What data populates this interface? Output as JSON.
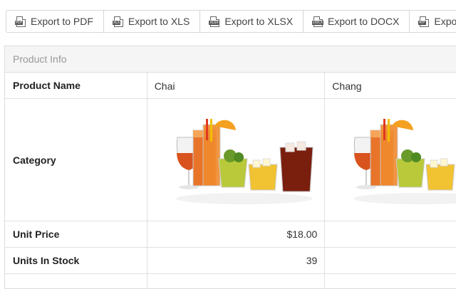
{
  "toolbar": {
    "buttons": [
      {
        "label": "Export to PDF",
        "icon": "pdf-file-icon",
        "tag": "PDF"
      },
      {
        "label": "Export to XLS",
        "icon": "xls-file-icon",
        "tag": "XLS"
      },
      {
        "label": "Export to XLSX",
        "icon": "xlsx-file-icon",
        "tag": "XLSX"
      },
      {
        "label": "Export to DOCX",
        "icon": "docx-file-icon",
        "tag": "DOCX"
      },
      {
        "label": "Expo",
        "icon": "rtf-file-icon",
        "tag": "RTF"
      }
    ]
  },
  "grid": {
    "band_title": "Product Info",
    "rows": {
      "product_name": {
        "label": "Product Name",
        "values": [
          "Chai",
          "Chang"
        ]
      },
      "category": {
        "label": "Category",
        "image": "beverages-image"
      },
      "unit_price": {
        "label": "Unit Price",
        "values": [
          "$18.00",
          ""
        ]
      },
      "units_in_stock": {
        "label": "Units In Stock",
        "values": [
          "39",
          ""
        ]
      }
    }
  },
  "colors": {
    "border": "#dcdcdc",
    "band_bg": "#f5f5f5",
    "band_text": "#999999"
  }
}
